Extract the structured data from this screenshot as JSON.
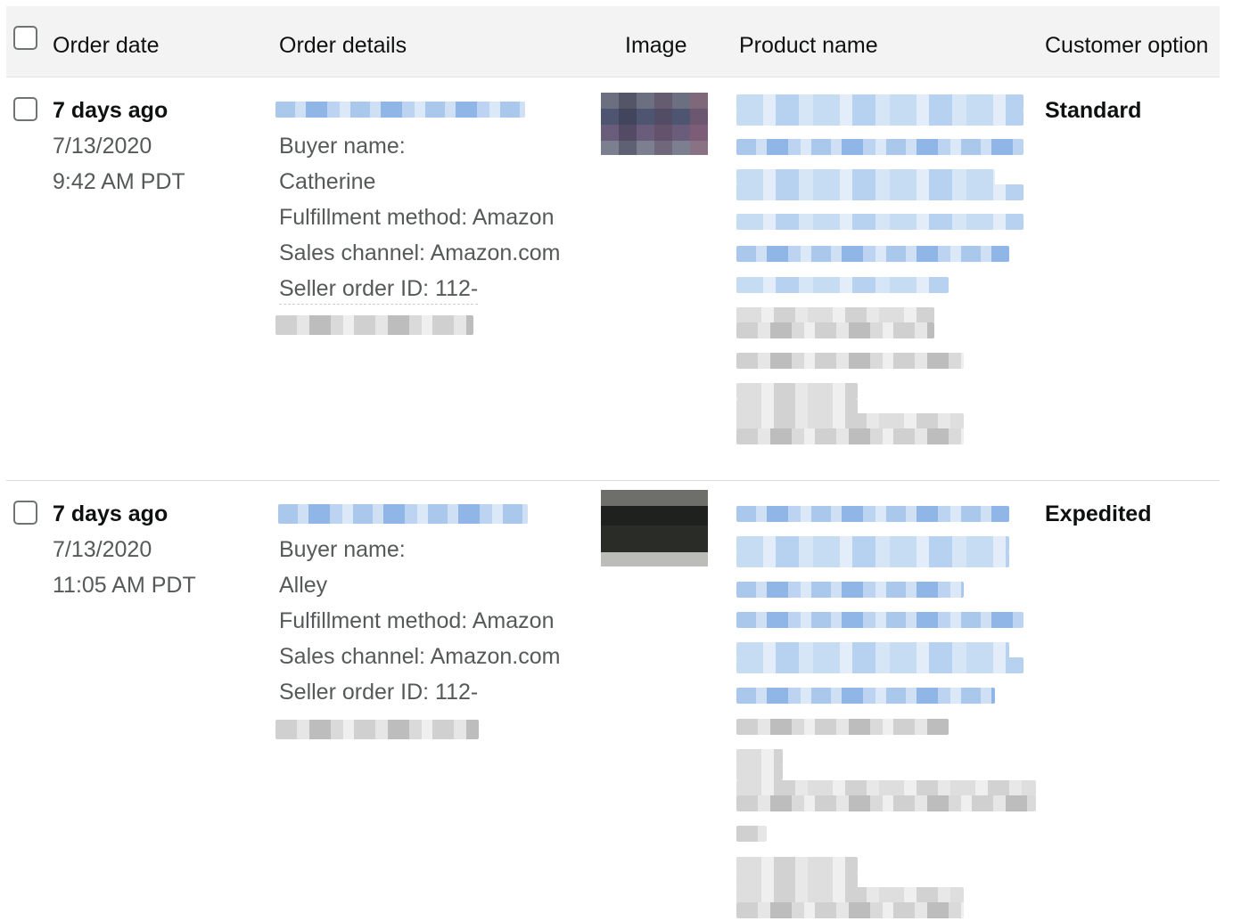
{
  "header": {
    "columns": [
      "Order date",
      "Order details",
      "Image",
      "Product name",
      "Customer option"
    ]
  },
  "orders": [
    {
      "relative_date": "7 days ago",
      "date": "7/13/2020",
      "time": "9:42 AM PDT",
      "buyer_label": "Buyer name:",
      "buyer_name": "Catherine",
      "fulfillment": "Fulfillment method: Amazon",
      "sales_channel": "Sales channel: Amazon.com",
      "seller_order_id": "Seller order ID: 112-",
      "customer_option": "Standard"
    },
    {
      "relative_date": "7 days ago",
      "date": "7/13/2020",
      "time": "11:05 AM PDT",
      "buyer_label": "Buyer name:",
      "buyer_name": "Alley",
      "fulfillment": "Fulfillment method: Amazon",
      "sales_channel": "Sales channel: Amazon.com",
      "seller_order_id": "Seller order ID: 112-",
      "customer_option": "Expedited"
    }
  ],
  "colors": {
    "header_bg": "#f3f3f3",
    "secondary_text": "#565959",
    "primary_text": "#0f1111",
    "redacted_link": "#a9c8ec",
    "redacted_text": "#d0d0d0"
  }
}
